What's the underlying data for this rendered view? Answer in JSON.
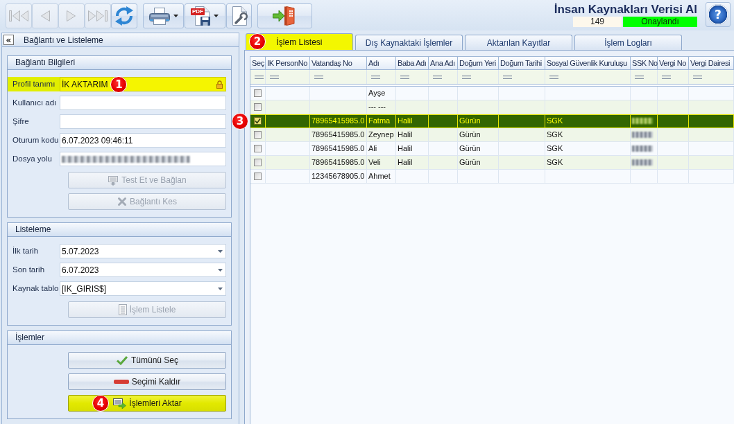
{
  "toolbar": {
    "groups": [
      {
        "buttons": [
          {
            "kind": "first",
            "disabled": true,
            "dropdown": false
          },
          {
            "kind": "previous",
            "disabled": true,
            "dropdown": false
          },
          {
            "kind": "next",
            "disabled": true,
            "dropdown": false
          },
          {
            "kind": "last",
            "disabled": true,
            "dropdown": false
          },
          {
            "kind": "refresh",
            "disabled": false,
            "dropdown": false
          }
        ]
      },
      {
        "buttons": [
          {
            "kind": "print",
            "disabled": false,
            "dropdown": true
          },
          {
            "kind": "pdf",
            "disabled": false,
            "dropdown": true,
            "tag": "PDF"
          },
          {
            "kind": "settings",
            "disabled": false,
            "dropdown": false
          }
        ]
      },
      {
        "buttons": [
          {
            "kind": "exit",
            "disabled": false,
            "dropdown": false
          }
        ]
      }
    ]
  },
  "header": {
    "title": "İnsan Kaynakları Verisi Al",
    "count": "149",
    "status": {
      "text": "Onaylandı",
      "approved": true
    },
    "help_label": "?"
  },
  "left_panel": {
    "title": "Bağlantı ve Listeleme",
    "collapse_label": "«",
    "sections": [
      {
        "title": "Bağlantı Bilgileri",
        "fields": [
          {
            "kind": "text",
            "label": "Profil tanımı",
            "value": "İK AKTARIM",
            "locked": true,
            "highlighted": true,
            "blurred": false,
            "marker": "1"
          },
          {
            "kind": "text",
            "label": "Kullanıcı adı",
            "locked": false,
            "highlighted": false,
            "blurred": false
          },
          {
            "kind": "text",
            "label": "Şifre",
            "locked": false,
            "highlighted": false,
            "blurred": false
          },
          {
            "kind": "text",
            "label": "Oturum kodu",
            "value": "6.07.2023 09:46:11",
            "locked": false,
            "highlighted": false,
            "blurred": false
          },
          {
            "kind": "text",
            "label": "Dosya yolu",
            "locked": false,
            "highlighted": false,
            "blurred": true
          }
        ],
        "buttons": [
          {
            "label": "Test Et ve Bağlan",
            "kind": "connect",
            "disabled": true,
            "highlighted": false
          },
          {
            "label": "Bağlantı Kes",
            "kind": "disconnect",
            "disabled": true,
            "highlighted": false
          }
        ]
      },
      {
        "title": "Listeleme",
        "fields": [
          {
            "kind": "dropdown",
            "label": "İlk tarih",
            "value": "5.07.2023",
            "locked": false,
            "highlighted": false,
            "blurred": false
          },
          {
            "kind": "dropdown",
            "label": "Son tarih",
            "value": "6.07.2023",
            "locked": false,
            "highlighted": false,
            "blurred": false
          },
          {
            "kind": "dropdown",
            "label": "Kaynak tablo",
            "value": "[IK_GIRIS$]",
            "locked": false,
            "highlighted": false,
            "blurred": false
          }
        ],
        "buttons": [
          {
            "label": "İşlem Listele",
            "kind": "list",
            "disabled": true,
            "highlighted": false
          }
        ]
      },
      {
        "title": "İşlemler",
        "buttons": [
          {
            "label": "Tümünü Seç",
            "kind": "check",
            "disabled": false,
            "highlighted": false
          },
          {
            "label": "Seçimi Kaldır",
            "kind": "minus",
            "disabled": false,
            "highlighted": false
          },
          {
            "label": "İşlemleri Aktar",
            "kind": "transfer",
            "disabled": false,
            "highlighted": true,
            "marker": "4"
          }
        ]
      }
    ]
  },
  "tabs": [
    {
      "label": "İşlem Listesi",
      "selected": true,
      "highlighted": true,
      "marker": "2"
    },
    {
      "label": "Dış Kaynaktaki İşlemler",
      "selected": false,
      "highlighted": false
    },
    {
      "label": "Aktarılan Kayıtlar",
      "selected": false,
      "highlighted": false
    },
    {
      "label": "İşlem Logları",
      "selected": false,
      "highlighted": false
    }
  ],
  "table": {
    "filter_row": true,
    "columns": [
      "Seç",
      "IK PersonNo",
      "Vatandaş No",
      "Adı",
      "Baba Adı",
      "Ana Adı",
      "Doğum Yeri",
      "Doğum Tarihi",
      "Sosyal Güvenlik Kuruluşu",
      "SSK No",
      "Vergi No",
      "Vergi Dairesi"
    ],
    "rows": [
      {
        "checked": false,
        "selected": false,
        "ssk_no_blurred": false,
        "cells": [
          null,
          null,
          null,
          "Ayşe",
          null,
          null,
          null,
          null,
          null,
          null,
          null,
          null
        ]
      },
      {
        "checked": false,
        "selected": false,
        "ssk_no_blurred": false,
        "cells": [
          null,
          null,
          null,
          "--- ---",
          null,
          null,
          null,
          null,
          null,
          null,
          null,
          null
        ]
      },
      {
        "checked": true,
        "selected": true,
        "ssk_no_blurred": true,
        "marker": "3",
        "cells": [
          null,
          null,
          "78965415985.0",
          "Fatma",
          "Halil",
          null,
          "Gürün",
          null,
          "SGK",
          null,
          null,
          null
        ]
      },
      {
        "checked": false,
        "selected": false,
        "ssk_no_blurred": true,
        "cells": [
          null,
          null,
          "78965415985.0",
          "Zeynep",
          "Halil",
          null,
          "Gürün",
          null,
          "SGK",
          null,
          null,
          null
        ]
      },
      {
        "checked": false,
        "selected": false,
        "ssk_no_blurred": true,
        "cells": [
          null,
          null,
          "78965415985.0",
          "Ali",
          "Halil",
          null,
          "Gürün",
          null,
          "SGK",
          null,
          null,
          null
        ]
      },
      {
        "checked": false,
        "selected": false,
        "ssk_no_blurred": true,
        "cells": [
          null,
          null,
          "78965415985.0",
          "Veli",
          "Halil",
          null,
          "Gürün",
          null,
          "SGK",
          null,
          null,
          null
        ]
      },
      {
        "checked": false,
        "selected": false,
        "ssk_no_blurred": false,
        "cells": [
          null,
          null,
          "12345678905.0",
          "Ahmet",
          null,
          null,
          null,
          null,
          null,
          null,
          null,
          null
        ]
      }
    ]
  }
}
